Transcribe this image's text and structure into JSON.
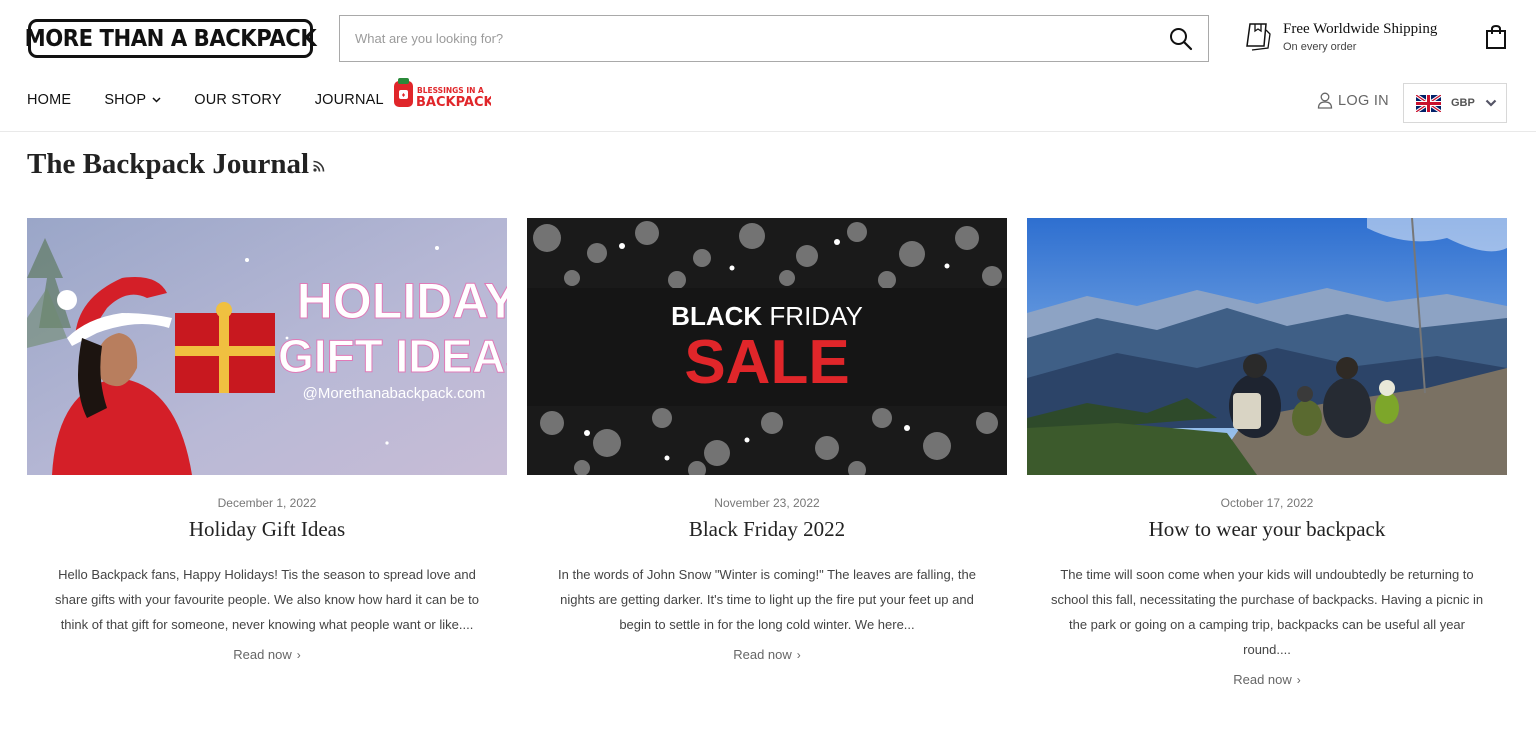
{
  "header": {
    "logo_text": "MORE THAN A BACKPACK",
    "search_placeholder": "What are you looking for?",
    "shipping_title": "Free Worldwide Shipping",
    "shipping_subtitle": "On every order"
  },
  "nav": {
    "items": [
      {
        "label": "HOME"
      },
      {
        "label": "SHOP",
        "has_dropdown": true
      },
      {
        "label": "OUR STORY"
      },
      {
        "label": "JOURNAL"
      }
    ],
    "blessings_logo_text": [
      "BLESSINGS IN A",
      "BACKPACK"
    ],
    "login_label": "LOG IN",
    "currency": "GBP"
  },
  "journal": {
    "title": "The Backpack Journal",
    "articles": [
      {
        "date": "December 1, 2022",
        "title": "Holiday Gift Ideas",
        "excerpt": "Hello Backpack fans, Happy Holidays! Tis the season to spread love and share gifts with your favourite people. We also know how hard it can be to think of that gift for someone, never knowing what people want or like....",
        "read_more": "Read now",
        "image_text": [
          "HOLIDAY",
          "GIFT IDEAS",
          "@Morethanabackpack.com"
        ]
      },
      {
        "date": "November 23, 2022",
        "title": "Black Friday 2022",
        "excerpt": "In the words of John Snow \"Winter is coming!\" The leaves are falling, the nights are getting darker. It's time to light up the fire put your feet up and begin to settle in for the long cold winter. We here...",
        "read_more": "Read now",
        "image_text": [
          "BLACK",
          "FRIDAY",
          "SALE"
        ]
      },
      {
        "date": "October 17, 2022",
        "title": "How to wear your backpack",
        "excerpt": "The time will soon come when your kids will undoubtedly be returning to school this fall, necessitating the purchase of backpacks. Having a picnic in the park or going on a camping trip, backpacks can be useful all year round....",
        "read_more": "Read now"
      }
    ]
  },
  "colors": {
    "accent_red": "#e0262a",
    "text_dark": "#222222",
    "text_muted": "#777777"
  }
}
